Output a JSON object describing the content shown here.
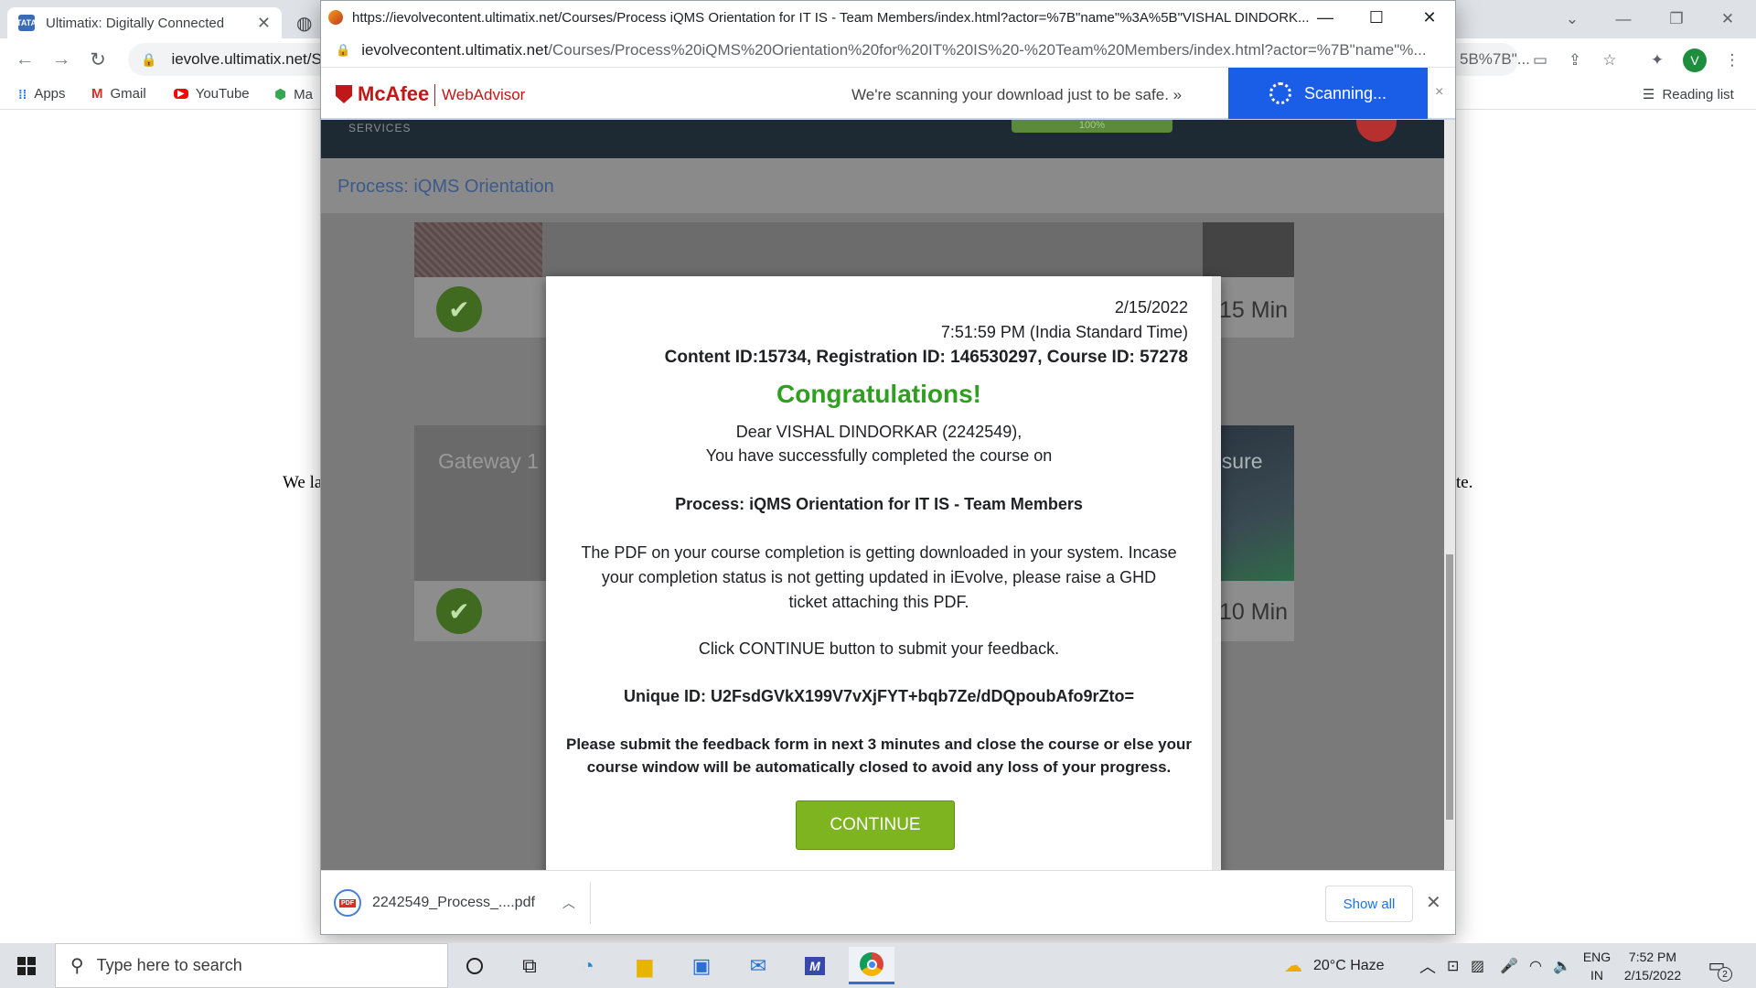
{
  "chrome": {
    "tabs": [
      {
        "title": "Ultimatix: Digitally Connected",
        "favicon_text": "TATA"
      }
    ],
    "address": "ievolve.ultimatix.net/Sc",
    "right_address_fragment": "5B%7B\"...",
    "profile_initial": "V",
    "bookmarks": [
      {
        "label": "Apps"
      },
      {
        "label": "Gmail"
      },
      {
        "label": "YouTube"
      },
      {
        "label": "Ma"
      }
    ],
    "reading_list": "Reading list"
  },
  "background_page": {
    "left_text": "We la",
    "right_text": "te."
  },
  "popup": {
    "title": "https://ievolvecontent.ultimatix.net/Courses/Process iQMS Orientation for IT IS - Team Members/index.html?actor=%7B\"name\"%3A%5B\"VISHAL DINDORK...",
    "address_host": "ievolvecontent.ultimatix.net",
    "address_path": "/Courses/Process%20iQMS%20Orientation%20for%20IT%20IS%20-%20Team%20Members/index.html?actor=%7B\"name\"%...",
    "mcafee": {
      "brand": "McAfee",
      "product": "WebAdvisor",
      "message": "We're scanning your download just to be safe. »",
      "scan_label": "Scanning...",
      "close": "×"
    },
    "course": {
      "services_label": "SERVICES",
      "progress_label": "100%",
      "title": "Process: iQMS Orientation",
      "cards": [
        {
          "title": "",
          "duration": "15 Min"
        },
        {
          "title": "Gateway 1",
          "title_right": "osure",
          "duration": "10 Min"
        }
      ]
    },
    "modal": {
      "date": "2/15/2022",
      "time": "7:51:59 PM (India Standard Time)",
      "ids": "Content ID:15734, Registration ID: 146530297, Course ID: 57278",
      "heading": "Congratulations!",
      "greeting": "Dear VISHAL DINDORKAR (2242549),",
      "completed": "You have successfully completed the course on",
      "course_name": "Process: iQMS Orientation for IT IS - Team Members",
      "pdf_line1": "The PDF on your course completion is getting downloaded in your system. Incase",
      "pdf_line2": "your completion status is not getting updated in iEvolve, please raise a GHD",
      "pdf_line3": "ticket attaching this PDF.",
      "continue_hint": "Click CONTINUE button to submit your feedback.",
      "unique_id": "Unique ID: U2FsdGVkX199V7vXjFYT+bqb7Ze/dDQpoubAfo9rZto=",
      "warning_line1": "Please submit the feedback form in next 3 minutes and close the course or else your",
      "warning_line2": "course window will be automatically closed to avoid any loss of your progress.",
      "continue_label": "CONTINUE"
    },
    "download": {
      "filename": "2242549_Process_....pdf",
      "file_badge": "PDF",
      "show_all": "Show all"
    }
  },
  "taskbar": {
    "search_placeholder": "Type here to search",
    "weather": "20°C  Haze",
    "lang_top": "ENG",
    "lang_bottom": "IN",
    "time": "7:52 PM",
    "date": "2/15/2022",
    "notification_count": "2"
  }
}
